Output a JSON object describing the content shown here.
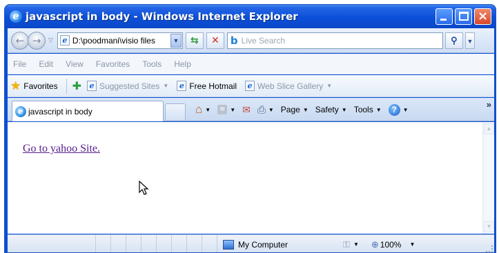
{
  "window": {
    "title": "javascript in body - Windows Internet Explorer"
  },
  "navigation": {
    "address": "D:\\poodmani\\visio files",
    "search_placeholder": "Live Search"
  },
  "menu": {
    "items": [
      "File",
      "Edit",
      "View",
      "Favorites",
      "Tools",
      "Help"
    ]
  },
  "favorites_bar": {
    "label": "Favorites",
    "links": [
      "Suggested Sites",
      "Free Hotmail",
      "Web Slice Gallery"
    ]
  },
  "tab": {
    "title": "javascript in body"
  },
  "command_bar": {
    "page": "Page",
    "safety": "Safety",
    "tools": "Tools"
  },
  "content": {
    "link_text": "Go to yahoo Site."
  },
  "status": {
    "zone": "My Computer",
    "zoom": "100%"
  },
  "colors": {
    "link_visited": "#551a8b",
    "title_bar": "#0c4fd8"
  },
  "icons": [
    "ie-logo-icon",
    "back-icon",
    "forward-icon",
    "refresh-icon",
    "stop-icon",
    "bing-icon",
    "search-icon",
    "favorites-star-icon",
    "add-favorites-icon",
    "home-icon",
    "feeds-icon",
    "mail-icon",
    "print-icon",
    "help-icon",
    "mouse-cursor-icon",
    "computer-icon",
    "zoom-icon"
  ]
}
